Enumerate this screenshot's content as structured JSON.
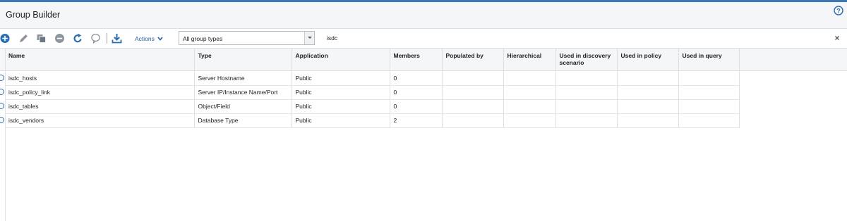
{
  "window": {
    "title": "Group Builder",
    "help_icon": "help-circle-icon"
  },
  "toolbar": {
    "icons": [
      "add-icon",
      "edit-icon",
      "copy-icon",
      "delete-icon",
      "refresh-icon",
      "comment-icon",
      "download-icon"
    ],
    "actions_label": "Actions",
    "group_type_select": {
      "value": "All group types"
    },
    "search": {
      "value": "isdc"
    }
  },
  "grid": {
    "columns": [
      "Name",
      "Type",
      "Application",
      "Members",
      "Populated by",
      "Hierarchical",
      "Used in discovery scenario",
      "Used in policy",
      "Used in query"
    ],
    "rows": [
      {
        "name": "isdc_hosts",
        "type": "Server Hostname",
        "application": "Public",
        "members": "0",
        "populated_by": "",
        "hierarchical": "",
        "discovery": "",
        "policy": "",
        "query": ""
      },
      {
        "name": "isdc_policy_link",
        "type": "Server IP/Instance Name/Port",
        "application": "Public",
        "members": "0",
        "populated_by": "",
        "hierarchical": "",
        "discovery": "",
        "policy": "",
        "query": ""
      },
      {
        "name": "isdc_tables",
        "type": "Object/Field",
        "application": "Public",
        "members": "0",
        "populated_by": "",
        "hierarchical": "",
        "discovery": "",
        "policy": "",
        "query": ""
      },
      {
        "name": "isdc_vendors",
        "type": "Database Type",
        "application": "Public",
        "members": "2",
        "populated_by": "",
        "hierarchical": "",
        "discovery": "",
        "policy": "",
        "query": ""
      }
    ]
  },
  "colors": {
    "accent": "#3d78b5",
    "link": "#1d5f9e",
    "header_bg": "#f5f6f7",
    "border": "#dde0e3"
  }
}
